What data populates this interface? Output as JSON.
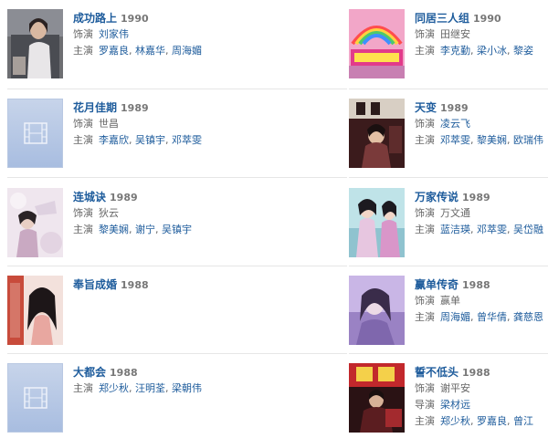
{
  "labels": {
    "role": "饰演",
    "cast": "主演",
    "director": "导演"
  },
  "left": [
    {
      "title": "成功路上",
      "year": "1990",
      "role": [
        "刘家伟"
      ],
      "role_link": true,
      "cast": [
        "罗嘉良",
        "林嘉华",
        "周海媚"
      ],
      "thumb": "photo-1"
    },
    {
      "title": "花月佳期",
      "year": "1989",
      "role": [
        "世昌"
      ],
      "role_link": false,
      "cast": [
        "李嘉欣",
        "吴镇宇",
        "邓萃雯"
      ],
      "thumb": "placeholder"
    },
    {
      "title": "连城诀",
      "year": "1989",
      "role": [
        "狄云"
      ],
      "role_link": false,
      "cast": [
        "黎美娴",
        "谢宁",
        "吴镇宇"
      ],
      "thumb": "photo-3"
    },
    {
      "title": "奉旨成婚",
      "year": "1988",
      "thumb": "photo-4"
    },
    {
      "title": "大都会",
      "year": "1988",
      "cast": [
        "郑少秋",
        "汪明荃",
        "梁朝伟"
      ],
      "thumb": "placeholder"
    }
  ],
  "right": [
    {
      "title": "同居三人组",
      "year": "1990",
      "role": [
        "田继安"
      ],
      "role_link": false,
      "cast": [
        "李克勤",
        "梁小冰",
        "黎姿"
      ],
      "thumb": "photo-6"
    },
    {
      "title": "天变",
      "year": "1989",
      "role": [
        "凌云飞"
      ],
      "role_link": true,
      "cast": [
        "邓萃雯",
        "黎美娴",
        "欧瑞伟"
      ],
      "thumb": "photo-7"
    },
    {
      "title": "万家传说",
      "year": "1989",
      "role": [
        "万文通"
      ],
      "role_link": false,
      "cast": [
        "蓝洁瑛",
        "邓萃雯",
        "吴岱融"
      ],
      "thumb": "photo-8"
    },
    {
      "title": "赢单传奇",
      "year": "1988",
      "role": [
        "赢单"
      ],
      "role_link": false,
      "cast": [
        "周海媚",
        "曾华倩",
        "龚慈恩"
      ],
      "thumb": "photo-9"
    },
    {
      "title": "誓不低头",
      "year": "1988",
      "role": [
        "谢平安"
      ],
      "role_link": false,
      "director": [
        "梁材远"
      ],
      "cast": [
        "郑少秋",
        "罗嘉良",
        "曾江"
      ],
      "thumb": "photo-10"
    }
  ],
  "icons": {
    "placeholder": "film-strip-icon"
  },
  "colors": {
    "link": "#1e5c9c",
    "placeholder_bg": "#b3c4e4",
    "separator": "#e6e6e6"
  }
}
